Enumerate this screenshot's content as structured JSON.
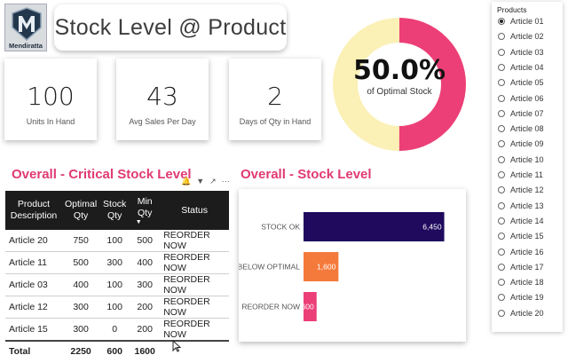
{
  "brand": {
    "name": "Mendiratta"
  },
  "header": {
    "title": "Stock Level @ Product"
  },
  "kpis": [
    {
      "value": "100",
      "label": "Units In Hand"
    },
    {
      "value": "43",
      "label": "Avg Sales Per Day"
    },
    {
      "value": "2",
      "label": "Days of Qty in Hand"
    }
  ],
  "gauge": {
    "value": "50.0%",
    "label": "of Optimal Stock",
    "fraction": 0.5,
    "fill_color": "#ec3f78",
    "track_color": "#fbf0b5"
  },
  "critical": {
    "title": "Overall - Critical Stock Level",
    "columns": [
      "Product Description",
      "Optimal Qty",
      "Stock Qty",
      "Min Qty",
      "Status"
    ],
    "rows": [
      [
        "Article 20",
        "750",
        "100",
        "500",
        "REORDER NOW"
      ],
      [
        "Article 11",
        "500",
        "300",
        "400",
        "REORDER NOW"
      ],
      [
        "Article 03",
        "400",
        "100",
        "300",
        "REORDER NOW"
      ],
      [
        "Article 12",
        "300",
        "100",
        "200",
        "REORDER NOW"
      ],
      [
        "Article 15",
        "300",
        "0",
        "200",
        "REORDER NOW"
      ]
    ],
    "total": [
      "Total",
      "2250",
      "600",
      "1600",
      ""
    ]
  },
  "chart_data": {
    "type": "bar",
    "orientation": "horizontal",
    "title": "Overall - Stock Level",
    "categories": [
      "STOCK OK",
      "BELOW OPTIMAL",
      "REORDER NOW"
    ],
    "values": [
      6450,
      1600,
      600
    ],
    "data_labels": [
      "6,450",
      "1,600",
      "600"
    ],
    "colors": [
      "#1f0a5e",
      "#f47a3c",
      "#ec3f78"
    ],
    "xlim": [
      0,
      7200
    ],
    "grid": false
  },
  "slicer": {
    "title": "Products",
    "selected": "Article 01",
    "items": [
      "Article 01",
      "Article 02",
      "Article 03",
      "Article 04",
      "Article 05",
      "Article 06",
      "Article 07",
      "Article 08",
      "Article 09",
      "Article 10",
      "Article 11",
      "Article 12",
      "Article 13",
      "Article 14",
      "Article 15",
      "Article 16",
      "Article 17",
      "Article 18",
      "Article 19",
      "Article 20"
    ]
  }
}
